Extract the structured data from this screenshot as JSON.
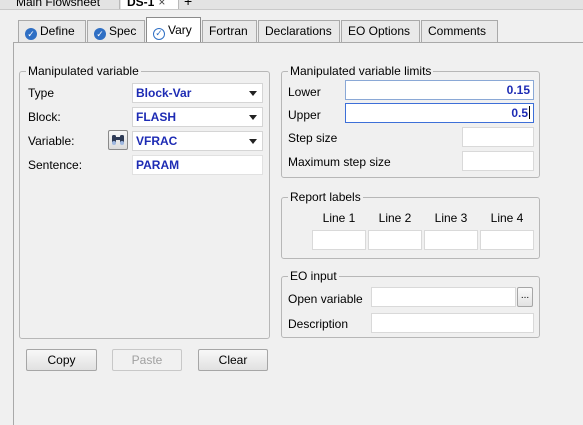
{
  "document_tabs": {
    "flowsheet": "Main Flowsheet",
    "ds1": "DS-1",
    "close_glyph": "×",
    "add_glyph": "+"
  },
  "form_tabs": [
    {
      "label": "Define",
      "status": "check-complete-icon"
    },
    {
      "label": "Spec",
      "status": "check-complete-icon"
    },
    {
      "label": "Vary",
      "status": "check-complete-icon",
      "active": true
    },
    {
      "label": "Fortran"
    },
    {
      "label": "Declarations"
    },
    {
      "label": "EO Options"
    },
    {
      "label": "Comments"
    }
  ],
  "manipulated_variable": {
    "title": "Manipulated variable",
    "type_label": "Type",
    "type_value": "Block-Var",
    "block_label": "Block:",
    "block_value": "FLASH",
    "variable_label": "Variable:",
    "variable_value": "VFRAC",
    "sentence_label": "Sentence:",
    "sentence_value": "PARAM"
  },
  "limits": {
    "title": "Manipulated variable limits",
    "lower_label": "Lower",
    "lower_value": "0.15",
    "upper_label": "Upper",
    "upper_value": "0.5",
    "step_label": "Step size",
    "step_value": "",
    "max_step_label": "Maximum step size",
    "max_step_value": ""
  },
  "report_labels": {
    "title": "Report labels",
    "columns": [
      "Line 1",
      "Line 2",
      "Line 3",
      "Line 4"
    ]
  },
  "eo_input": {
    "title": "EO input",
    "open_variable_label": "Open variable",
    "open_variable_value": "",
    "description_label": "Description",
    "description_value": "",
    "browse_glyph": "..."
  },
  "buttons": {
    "copy": "Copy",
    "paste": "Paste",
    "clear": "Clear"
  },
  "colors": {
    "value_text": "#1d2bb4",
    "status_check": "#2f6fc4"
  }
}
